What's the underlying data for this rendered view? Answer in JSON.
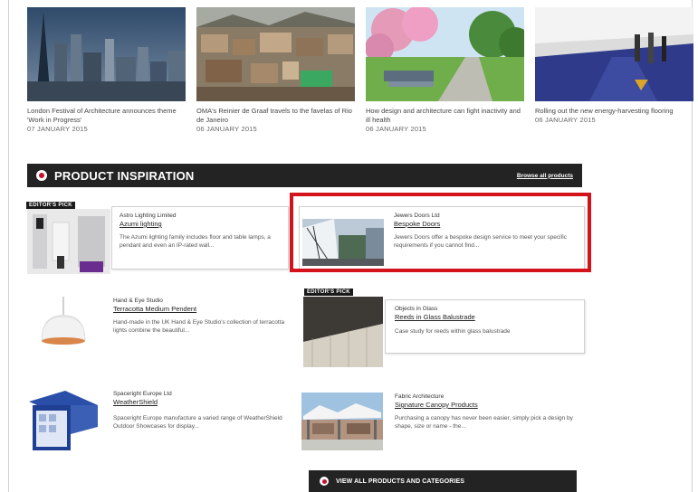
{
  "news": [
    {
      "title": "London Festival of Architecture announces theme 'Work in Progress'",
      "date": "07 JANUARY 2015"
    },
    {
      "title": "OMA's Reinier de Graaf travels to the favelas of Rio de Janeiro",
      "date": "06 JANUARY 2015"
    },
    {
      "title": "How design and architecture can fight inactivity and ill health",
      "date": "06 JANUARY 2015"
    },
    {
      "title": "Rolling out the new energy-harvesting flooring",
      "date": "06 JANUARY 2015"
    }
  ],
  "section": {
    "title": "PRODUCT INSPIRATION",
    "browse_label": "Browse all products"
  },
  "editors_pick_label": "EDITOR'S PICK",
  "products": [
    {
      "brand": "Astro Lighting Limited",
      "name": "Azumi lighting",
      "desc": "The Azumi lighting family includes floor and table lamps, a pendant and even an IP-rated wall..."
    },
    {
      "brand": "Jewers Doors Ltd",
      "name": "Bespoke Doors",
      "desc": "Jewers Doors offer a bespoke design service to meet your specific requirements if you cannot find..."
    },
    {
      "brand": "Hand & Eye Studio",
      "name": "Terracotta Medium Pendent",
      "desc": "Hand-made in the UK Hand & Eye Studio's collection of terracotta lights combine the beautiful..."
    },
    {
      "brand": "Objects in Glass",
      "name": "Reeds in Glass Balustrade",
      "desc": "Case study for reeds within glass balustrade"
    },
    {
      "brand": "Spaceright Europe Ltd",
      "name": "WeatherShield",
      "desc": "Spaceright Europe manufacture a varied range of WeatherShield Outdoor Showcases for display..."
    },
    {
      "brand": "Fabric Architecture",
      "name": "Signature Canopy Products",
      "desc": "Purchasing a canopy has never been easier, simply pick a design by shape, size or name - the..."
    }
  ],
  "bottom": {
    "label": "VIEW ALL PRODUCTS AND CATEGORIES"
  },
  "colors": {
    "bar": "#232323",
    "highlight": "#d4121c",
    "brand_red": "#c4122f"
  }
}
